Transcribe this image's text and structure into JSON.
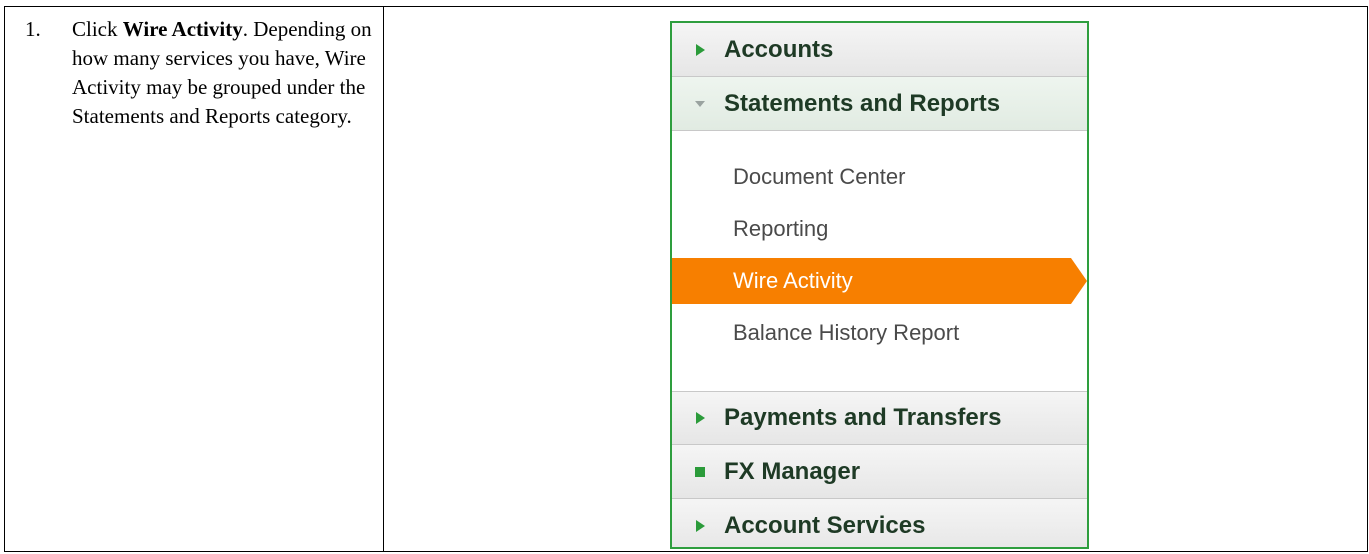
{
  "instruction": {
    "number": "1.",
    "prefix": "Click ",
    "bold": "Wire Activity",
    "suffix": ". Depending on how many services you have, Wire Activity may be grouped under the Statements and Reports category."
  },
  "menu": {
    "sections": [
      {
        "label": "Accounts",
        "marker": "right-arrow-icon"
      },
      {
        "label": "Statements and Reports",
        "marker": "down-arrow-icon"
      },
      {
        "label": "Payments and Transfers",
        "marker": "right-arrow-icon"
      },
      {
        "label": "FX Manager",
        "marker": "square-icon"
      },
      {
        "label": "Account Services",
        "marker": "right-arrow-icon"
      }
    ],
    "sub_items": [
      {
        "label": "Document Center"
      },
      {
        "label": "Reporting"
      },
      {
        "label": "Wire Activity"
      },
      {
        "label": "Balance History Report"
      }
    ],
    "active_item": "Wire Activity",
    "colors": {
      "border": "#2e9e3e",
      "active_bg": "#f77f00",
      "arrow": "#2b9b3a",
      "header_text": "#1e3a25"
    }
  }
}
